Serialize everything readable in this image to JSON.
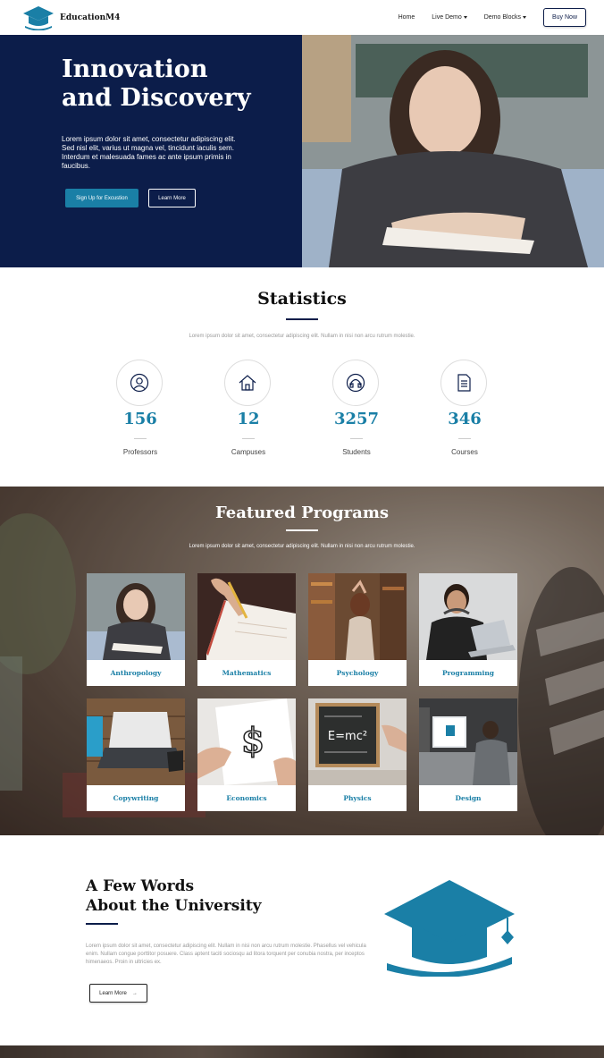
{
  "nav": {
    "brand": "EducationM4",
    "links": [
      {
        "label": "Home",
        "dropdown": false
      },
      {
        "label": "Live Demo",
        "dropdown": true
      },
      {
        "label": "Demo Blocks",
        "dropdown": true
      }
    ],
    "buy_label": "Buy Now"
  },
  "hero": {
    "title_line1": "Innovation",
    "title_line2": "and Discovery",
    "text": "Lorem ipsum dolor sit amet, consectetur adipiscing elit. Sed nisl elit, varius ut magna vel, tincidunt iaculis sem. Interdum et malesuada fames ac ante ipsum primis in faucibus.",
    "primary_button": "Sign Up for Excustion",
    "secondary_button": "Learn More"
  },
  "statistics": {
    "title": "Statistics",
    "subtitle": "Lorem ipsum dolor sit amet, consectetur adipiscing elit. Nullam in nisi non arcu rutrum molestie.",
    "items": [
      {
        "icon": "user-icon",
        "value": "156",
        "label": "Professors"
      },
      {
        "icon": "home-icon",
        "value": "12",
        "label": "Campuses"
      },
      {
        "icon": "headphones-icon",
        "value": "3257",
        "label": "Students"
      },
      {
        "icon": "document-icon",
        "value": "346",
        "label": "Courses"
      }
    ]
  },
  "featured": {
    "title": "Featured Programs",
    "subtitle": "Lorem ipsum dolor sit amet, consectetur adipiscing elit. Nullam in nisi non arcu rutrum molestie.",
    "programs": [
      {
        "label": "Anthropology"
      },
      {
        "label": "Mathematics"
      },
      {
        "label": "Psychology"
      },
      {
        "label": "Programming"
      },
      {
        "label": "Copywriting"
      },
      {
        "label": "Economics"
      },
      {
        "label": "Physics"
      },
      {
        "label": "Design"
      }
    ]
  },
  "about": {
    "title_line1": "A Few Words",
    "title_line2": "About the University",
    "text": "Lorem ipsum dolor sit amet, consectetur adipiscing elit. Nullam in nisi non arcu rutrum molestie. Phasellus vel vehicula enim. Nullam congue porttitor posuere. Class aptent taciti sociosqu ad litora torquent per conubia nostra, per inceptos himenaeos. Proin in ultricies ex.",
    "button": "Learn More"
  },
  "colors": {
    "navy": "#0c1d4a",
    "accent": "#1a7fa6"
  }
}
